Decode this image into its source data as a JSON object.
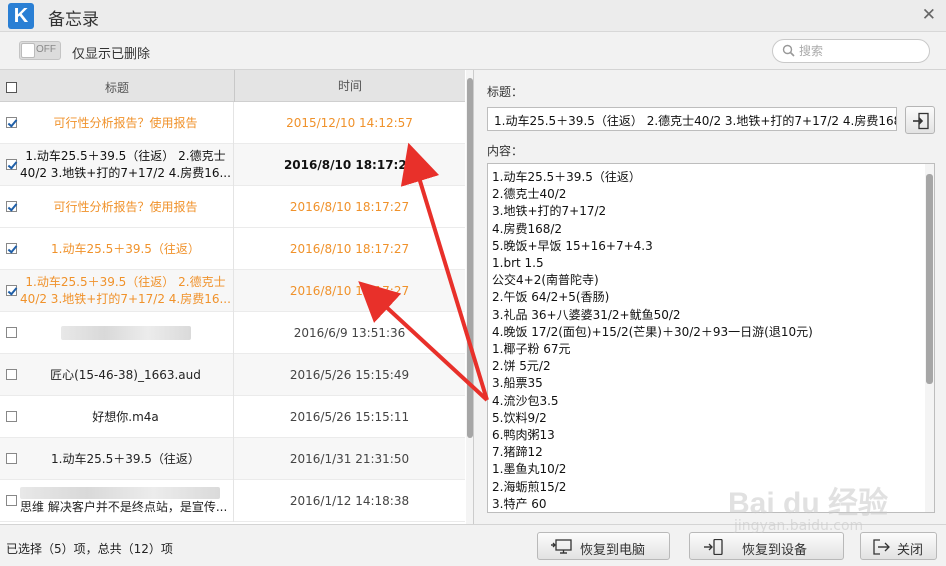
{
  "app": {
    "title": "备忘录",
    "logo_letter": "K"
  },
  "toolbar": {
    "toggle_state": "OFF",
    "toggle_label": "仅显示已删除",
    "search_placeholder": "搜索"
  },
  "table": {
    "headers": {
      "title": "标题",
      "time": "时间"
    },
    "rows": [
      {
        "title": "可行性分析报告？使用报告",
        "time": "2015/12/10 14:12:57",
        "checked": true
      },
      {
        "title": "1.动车25.5＋39.5（往返） 2.德克士40/2 3.地铁+打的7+17/2 4.房费16...",
        "time": "2016/8/10 18:17:27",
        "checked": true
      },
      {
        "title": "可行性分析报告？使用报告",
        "time": "2016/8/10 18:17:27",
        "checked": true
      },
      {
        "title": "1.动车25.5＋39.5（往返）",
        "time": "2016/8/10 18:17:27",
        "checked": true
      },
      {
        "title": "1.动车25.5＋39.5（往返） 2.德克士40/2 3.地铁+打的7+17/2 4.房费16...",
        "time": "2016/8/10 18:17:27",
        "checked": true
      },
      {
        "title": "",
        "time": "2016/6/9 13:51:36",
        "checked": false
      },
      {
        "title": "匠心(15-46-38)_1663.aud",
        "time": "2016/5/26 15:15:49",
        "checked": false
      },
      {
        "title": "好想你.m4a",
        "time": "2016/5/26 15:15:11",
        "checked": false
      },
      {
        "title": "1.动车25.5＋39.5（往返）",
        "time": "2016/1/31 21:31:50",
        "checked": false
      },
      {
        "title": "思维 解决客户并不是终点站，是宣传...",
        "time": "2016/1/12 14:18:38",
        "checked": false
      }
    ]
  },
  "detail": {
    "title_label": "标题：",
    "title_value": "1.动车25.5＋39.5（往返） 2.德克士40/2 3.地铁+打的7+17/2 4.房费168/2 5",
    "content_label": "内容：",
    "content_lines": [
      "1.动车25.5＋39.5（往返）",
      "2.德克士40/2",
      "3.地铁+打的7+17/2",
      "4.房费168/2",
      "5.晚饭+早饭 15+16+7+4.3",
      "1.brt 1.5",
      "公交4+2(南普陀寺)",
      "2.午饭 64/2+5(香肠)",
      "3.礼品 36+八婆婆31/2+鱿鱼50/2",
      "4.晚饭 17/2(面包)+15/2(芒果)＋30/2＋93一日游(退10元)",
      "1.椰子粉 67元",
      "2.饼 5元/2",
      "3.船票35",
      "4.流沙包3.5",
      "5.饮料9/2",
      "6.鸭肉粥13",
      "7.猪蹄12",
      "1.墨鱼丸10/2",
      "2.海蛎煎15/2",
      "3.特产 60"
    ]
  },
  "status": {
    "text": "已选择（5）项，总共（12）项",
    "btn_restore_pc": "恢复到电脑",
    "btn_restore_device": "恢复到设备",
    "btn_close": "关闭"
  },
  "watermark": {
    "text": "Bai du 经验",
    "url": "jingyan.baidu.com"
  },
  "colors": {
    "selected_text": "#f0922b",
    "arrow": "#e8302a",
    "logo_bg": "#2a7fd4"
  }
}
